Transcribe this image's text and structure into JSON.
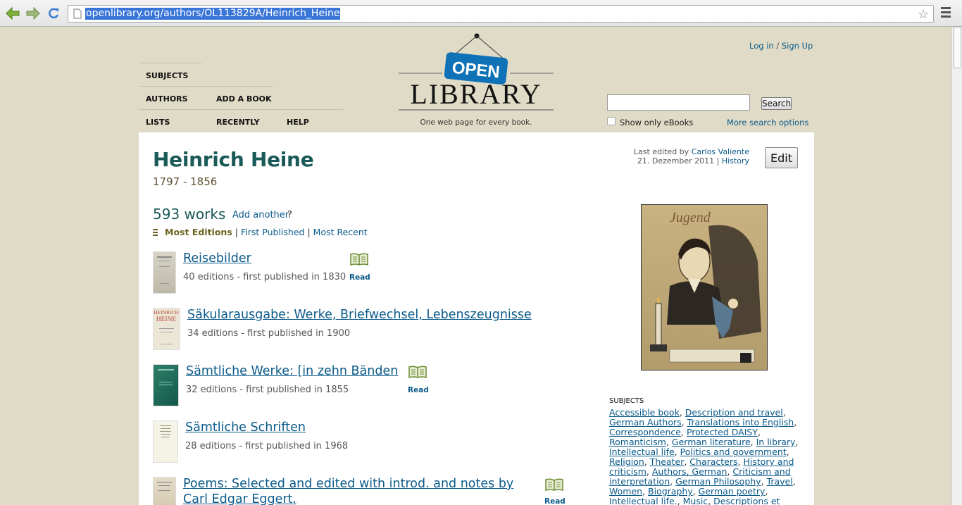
{
  "browser": {
    "url": "openlibrary.org/authors/OL113829A/Heinrich_Heine"
  },
  "header": {
    "nav": {
      "subjects": "SUBJECTS",
      "authors": "AUTHORS",
      "add_book": "ADD A BOOK",
      "lists": "LISTS",
      "recently": "RECENTLY",
      "help": "HELP"
    },
    "logo": {
      "top": "OPEN",
      "bottom": "LIBRARY"
    },
    "tagline": "One web page for every book.",
    "login": "Log in",
    "login_sep": "/",
    "signup": "Sign Up",
    "search_button": "Search",
    "ebooks_label": "Show only eBooks",
    "more_search": "More search options"
  },
  "author": {
    "name": "Heinrich Heine",
    "dates": "1797 - 1856",
    "last_edited_prefix": "Last edited by",
    "last_edited_by": "Carlos Valiente",
    "last_edited_date": "21. Dezember 2011",
    "history": "History",
    "edit_button": "Edit"
  },
  "works": {
    "count": "593 works",
    "add_another": "Add another",
    "add_another_suffix": "?",
    "sort": {
      "most_editions": "Most Editions",
      "first_published": "First Published",
      "most_recent": "Most Recent"
    },
    "items": [
      {
        "title": "Reisebilder",
        "meta": "40 editions - first published in 1830",
        "read": "Read"
      },
      {
        "title": "Säkularausgabe: Werke, Briefwechsel, Lebenszeugnisse",
        "meta": "34 editions - first published in 1900"
      },
      {
        "title": "Sämtliche Werke: [in zehn Bänden",
        "meta": "32 editions - first published in 1855",
        "read": "Read"
      },
      {
        "title": "Sämtliche Schriften",
        "meta": "28 editions - first published in 1968"
      },
      {
        "title": "Poems: Selected and edited with introd. and notes by",
        "title_line2": "Carl Edgar Eggert.",
        "read": "Read"
      }
    ],
    "cover_texts": {
      "heine_cover_top": "HEINRICH",
      "heine_cover_bottom": "HEINE"
    }
  },
  "sidebar": {
    "photo_caption": "Jugend",
    "subjects_heading": "SUBJECTS",
    "subjects": [
      "Accessible book",
      "Description and travel",
      "German Authors",
      "Translations into English",
      "Correspondence",
      "Protected DAISY",
      "Romanticism",
      "German literature",
      "In library",
      "Intellectual life",
      "Politics and government",
      "Religion",
      "Theater",
      "Characters",
      "History and criticism",
      "Authors, German",
      "Criticism and interpretation",
      "German Philosophy",
      "Travel",
      "Women",
      "Biography",
      "German poetry",
      "Intellectual life.",
      "Music",
      "Descriptions et"
    ]
  },
  "colors": {
    "page_bg": "#e0dbc6",
    "link": "#0a5a8a",
    "author_name": "#1a5a58",
    "logo_blue": "#0f72b6"
  }
}
